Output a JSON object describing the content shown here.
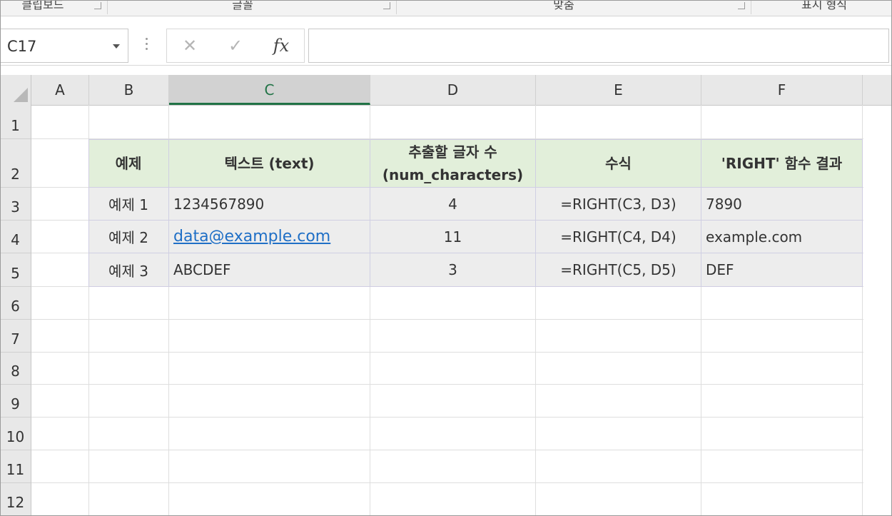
{
  "ribbon": {
    "groups": [
      "클립보드",
      "글꼴",
      "맞춤",
      "표시 형식"
    ]
  },
  "formula_bar": {
    "name_box": "C17",
    "cancel_glyph": "✕",
    "enter_glyph": "✓",
    "fx_glyph": "fx",
    "formula_value": ""
  },
  "sheet": {
    "selected_column": "C",
    "columns": [
      "A",
      "B",
      "C",
      "D",
      "E",
      "F"
    ],
    "rows": [
      "1",
      "2",
      "3",
      "4",
      "5",
      "6",
      "7",
      "8",
      "9",
      "10",
      "11",
      "12"
    ],
    "table": {
      "headers": [
        "예제",
        "텍스트 (text)",
        "추출할 글자 수\n(num_characters)",
        "수식",
        "'RIGHT' 함수 결과"
      ],
      "header_line1_d": "추출할 글자 수",
      "header_line2_d": "(num_characters)",
      "rows": [
        {
          "example": "예제 1",
          "text": "1234567890",
          "num": "4",
          "formula": "=RIGHT(C3, D3)",
          "result": "7890"
        },
        {
          "example": "예제 2",
          "text": "data@example.com",
          "num": "11",
          "formula": "=RIGHT(C4, D4)",
          "result": "example.com"
        },
        {
          "example": "예제 3",
          "text": "ABCDEF",
          "num": "3",
          "formula": "=RIGHT(C5, D5)",
          "result": "DEF"
        }
      ]
    }
  },
  "colors": {
    "header_fill": "#e2efda",
    "body_fill": "#ededed",
    "link": "#1f6fc6",
    "selection_accent": "#217346"
  }
}
